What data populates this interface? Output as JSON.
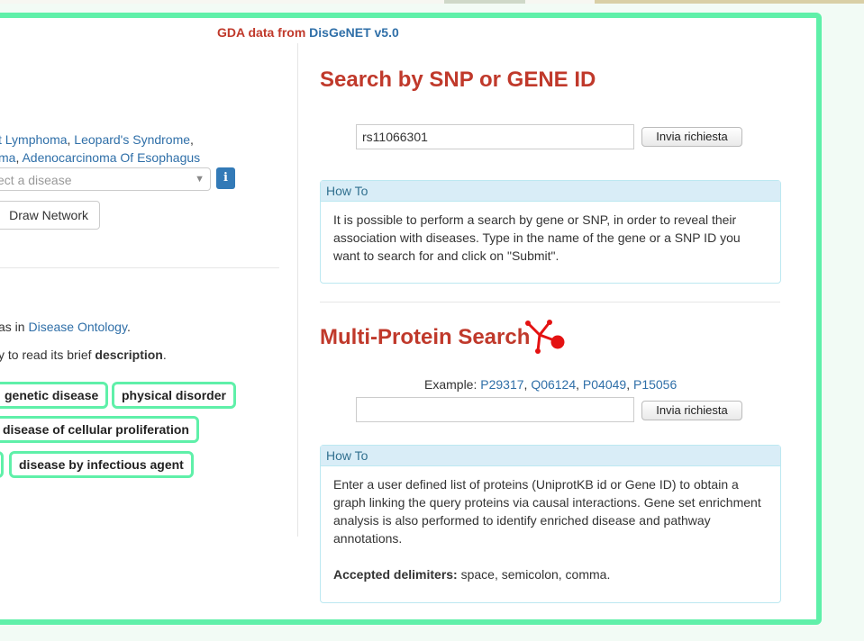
{
  "header": {
    "gda_prefix": "GDA data from",
    "gda_source": "DisGeNET v5.0"
  },
  "left": {
    "examples": [
      {
        "text": "t Lymphoma",
        "sep": ", "
      },
      {
        "text": "Leopard's Syndrome",
        "sep": ","
      },
      {
        "text": "ma",
        "sep": ", "
      },
      {
        "text": "Adenocarcinoma Of Esophagus",
        "sep": ""
      }
    ],
    "disease_select_placeholder": "ect a disease",
    "info_icon": "i",
    "draw_network_label": "Draw Network",
    "ontology_prefix": "as in ",
    "ontology_link": "Disease Ontology",
    "ontology_suffix": ".",
    "description_prefix": "y to read its brief ",
    "description_bold": "description",
    "description_suffix": ".",
    "tags": [
      "genetic disease",
      "physical disorder",
      "disease of cellular proliferation",
      "disease by infectious agent"
    ]
  },
  "right": {
    "snp_title": "Search by SNP or GENE ID",
    "snp_input_value": "rs11066301",
    "submit_label": "Invia richiesta",
    "howto_title": "How To",
    "howto_snp_text": "It is possible to perform a search by gene or SNP, in order to reveal their association with diseases. Type in the name of the gene or a SNP ID you want to search for and click on \"Submit\".",
    "multi_title": "Multi-Protein Search",
    "multi_icon": "network-molecule-icon",
    "example_label": "Example:",
    "example_ids": [
      "P29317",
      "Q06124",
      "P04049",
      "P15056"
    ],
    "multi_input_value": "",
    "howto_multi_text": "Enter a user defined list of proteins (UniprotKB id or Gene ID) to obtain a graph linking the query proteins via causal interactions. Gene set enrichment analysis is also performed to identify enriched disease and pathway annotations.",
    "delimiters_label": "Accepted delimiters:",
    "delimiters_text": "space, semicolon, comma."
  },
  "colors": {
    "accent_green": "#5ff0a9",
    "title_red": "#c0392b",
    "link_blue": "#2f6fa8",
    "howto_header": "#d9edf7"
  }
}
